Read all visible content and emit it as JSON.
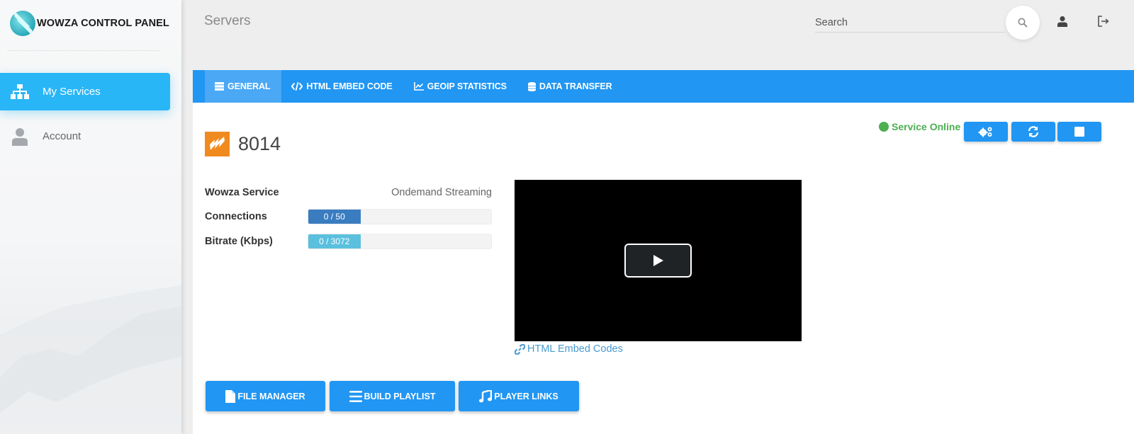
{
  "app": {
    "name": "WOWZA CONTROL PANEL"
  },
  "sidebar": {
    "items": [
      {
        "label": "My Services",
        "icon": "sitemap-icon",
        "active": true
      },
      {
        "label": "Account",
        "icon": "user-icon",
        "active": false
      }
    ]
  },
  "header": {
    "title": "Servers",
    "search": {
      "placeholder": "Search",
      "value": ""
    },
    "icons": [
      "search-icon",
      "user-icon",
      "logout-icon"
    ]
  },
  "tabs": [
    {
      "label": "GENERAL",
      "icon": "server-icon",
      "active": true
    },
    {
      "label": "HTML EMBED CODE",
      "icon": "code-icon",
      "active": false
    },
    {
      "label": "GEOIP STATISTICS",
      "icon": "line-chart-icon",
      "active": false
    },
    {
      "label": "DATA TRANSFER",
      "icon": "database-icon",
      "active": false
    }
  ],
  "service": {
    "name": "8014",
    "status": "Service Online",
    "actions": [
      "settings-cogs-icon",
      "refresh-icon",
      "stop-icon"
    ],
    "details": {
      "type_label": "Wowza Service",
      "type_value": "Ondemand Streaming",
      "connections_label": "Connections",
      "connections_text": "0 / 50",
      "connections_used": 0,
      "connections_max": 50,
      "bitrate_label": "Bitrate (Kbps)",
      "bitrate_text": "0 / 3072",
      "bitrate_used": 0,
      "bitrate_max": 3072
    },
    "embed_link": "HTML Embed Codes"
  },
  "bottom_buttons": [
    {
      "label": "FILE MANAGER",
      "icon": "file-icon"
    },
    {
      "label": "BUILD PLAYLIST",
      "icon": "list-icon"
    },
    {
      "label": "PLAYER LINKS",
      "icon": "music-icon"
    }
  ],
  "colors": {
    "primary": "#2196f3",
    "sidebar_active": "#29b6f6",
    "online": "#4caf50",
    "connections_bar": "#3a7cc0",
    "bitrate_bar": "#5bc0de",
    "brand_orange": "#f08a1e"
  }
}
